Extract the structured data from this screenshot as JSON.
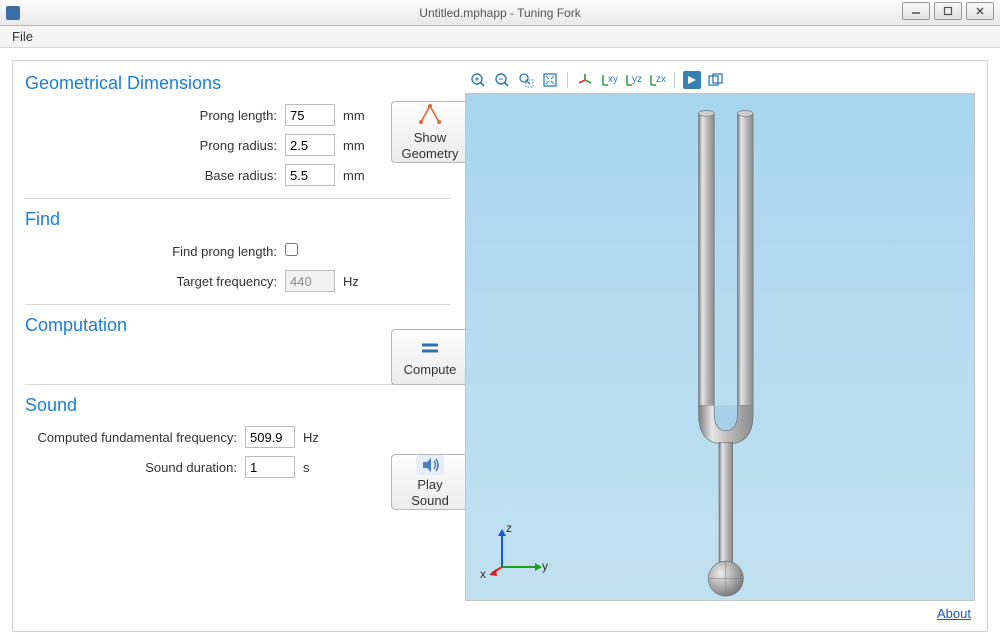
{
  "window": {
    "title": "Untitled.mphapp - Tuning Fork"
  },
  "menu": {
    "file": "File"
  },
  "sections": {
    "geom": {
      "title": "Geometrical Dimensions",
      "prong_length_label": "Prong length:",
      "prong_length": "75",
      "prong_radius_label": "Prong radius:",
      "prong_radius": "2.5",
      "base_radius_label": "Base radius:",
      "base_radius": "5.5",
      "unit_mm": "mm",
      "show_geometry_line1": "Show",
      "show_geometry_line2": "Geometry"
    },
    "find": {
      "title": "Find",
      "find_prong_length_label": "Find prong length:",
      "target_freq_label": "Target frequency:",
      "target_freq": "440",
      "unit_hz": "Hz"
    },
    "computation": {
      "title": "Computation",
      "compute_label": "Compute"
    },
    "sound": {
      "title": "Sound",
      "computed_freq_label": "Computed fundamental frequency:",
      "computed_freq": "509.9",
      "unit_hz": "Hz",
      "duration_label": "Sound duration:",
      "duration": "1",
      "unit_s": "s",
      "play_label": "Play Sound"
    }
  },
  "viewer": {
    "toolbar": {
      "xy": "xy",
      "yz": "yz",
      "zx": "zx"
    },
    "axes": {
      "x": "x",
      "y": "y",
      "z": "z"
    }
  },
  "footer": {
    "about": "About"
  }
}
